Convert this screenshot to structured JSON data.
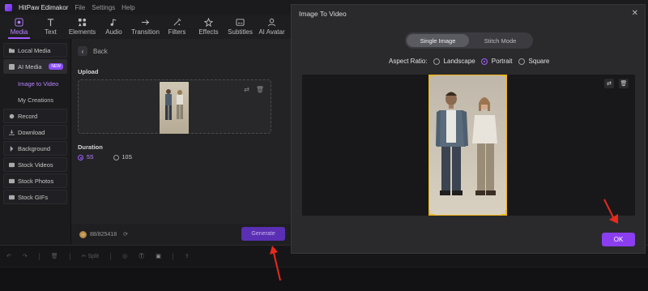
{
  "titlebar": {
    "app_name": "HitPaw Edimakor",
    "menus": [
      "File",
      "Settings",
      "Help"
    ]
  },
  "toolbar": {
    "items": [
      {
        "label": "Media",
        "icon": "media-icon",
        "active": true
      },
      {
        "label": "Text",
        "icon": "text-icon"
      },
      {
        "label": "Elements",
        "icon": "elements-icon"
      },
      {
        "label": "Audio",
        "icon": "audio-icon"
      },
      {
        "label": "Transition",
        "icon": "transition-icon"
      },
      {
        "label": "Filters",
        "icon": "filters-icon"
      },
      {
        "label": "Effects",
        "icon": "effects-icon"
      },
      {
        "label": "Subtitles",
        "icon": "subtitles-icon"
      },
      {
        "label": "AI Avatar",
        "icon": "ai-avatar-icon"
      }
    ]
  },
  "sidebar": {
    "local_media": "Local Media",
    "ai_media": "AI Media",
    "new_badge": "NEW",
    "image_to_video": "Image to Video",
    "my_creations": "My Creations",
    "record": "Record",
    "download": "Download",
    "background": "Background",
    "stock_videos": "Stock Videos",
    "stock_photos": "Stock Photos",
    "stock_gifs": "Stock GIFs"
  },
  "panel": {
    "back": "Back",
    "upload_label": "Upload",
    "duration_label": "Duration",
    "duration_options": [
      "5S",
      "10S"
    ],
    "duration_selected": "5S",
    "credits": "88/825418",
    "generate": "Generate"
  },
  "timeline": {
    "split_label": "Split"
  },
  "dialog": {
    "title": "Image To Video",
    "close": "✕",
    "tabs": [
      "Single Image",
      "Stitch Mode"
    ],
    "active_tab": "Single Image",
    "aspect_label": "Aspect Ratio:",
    "aspect_options": [
      "Landscape",
      "Portrait",
      "Square"
    ],
    "aspect_selected": "Portrait",
    "ok": "OK"
  },
  "colors": {
    "accent": "#8b3df0",
    "frame": "#f2b418",
    "arrow": "#e8291c"
  }
}
